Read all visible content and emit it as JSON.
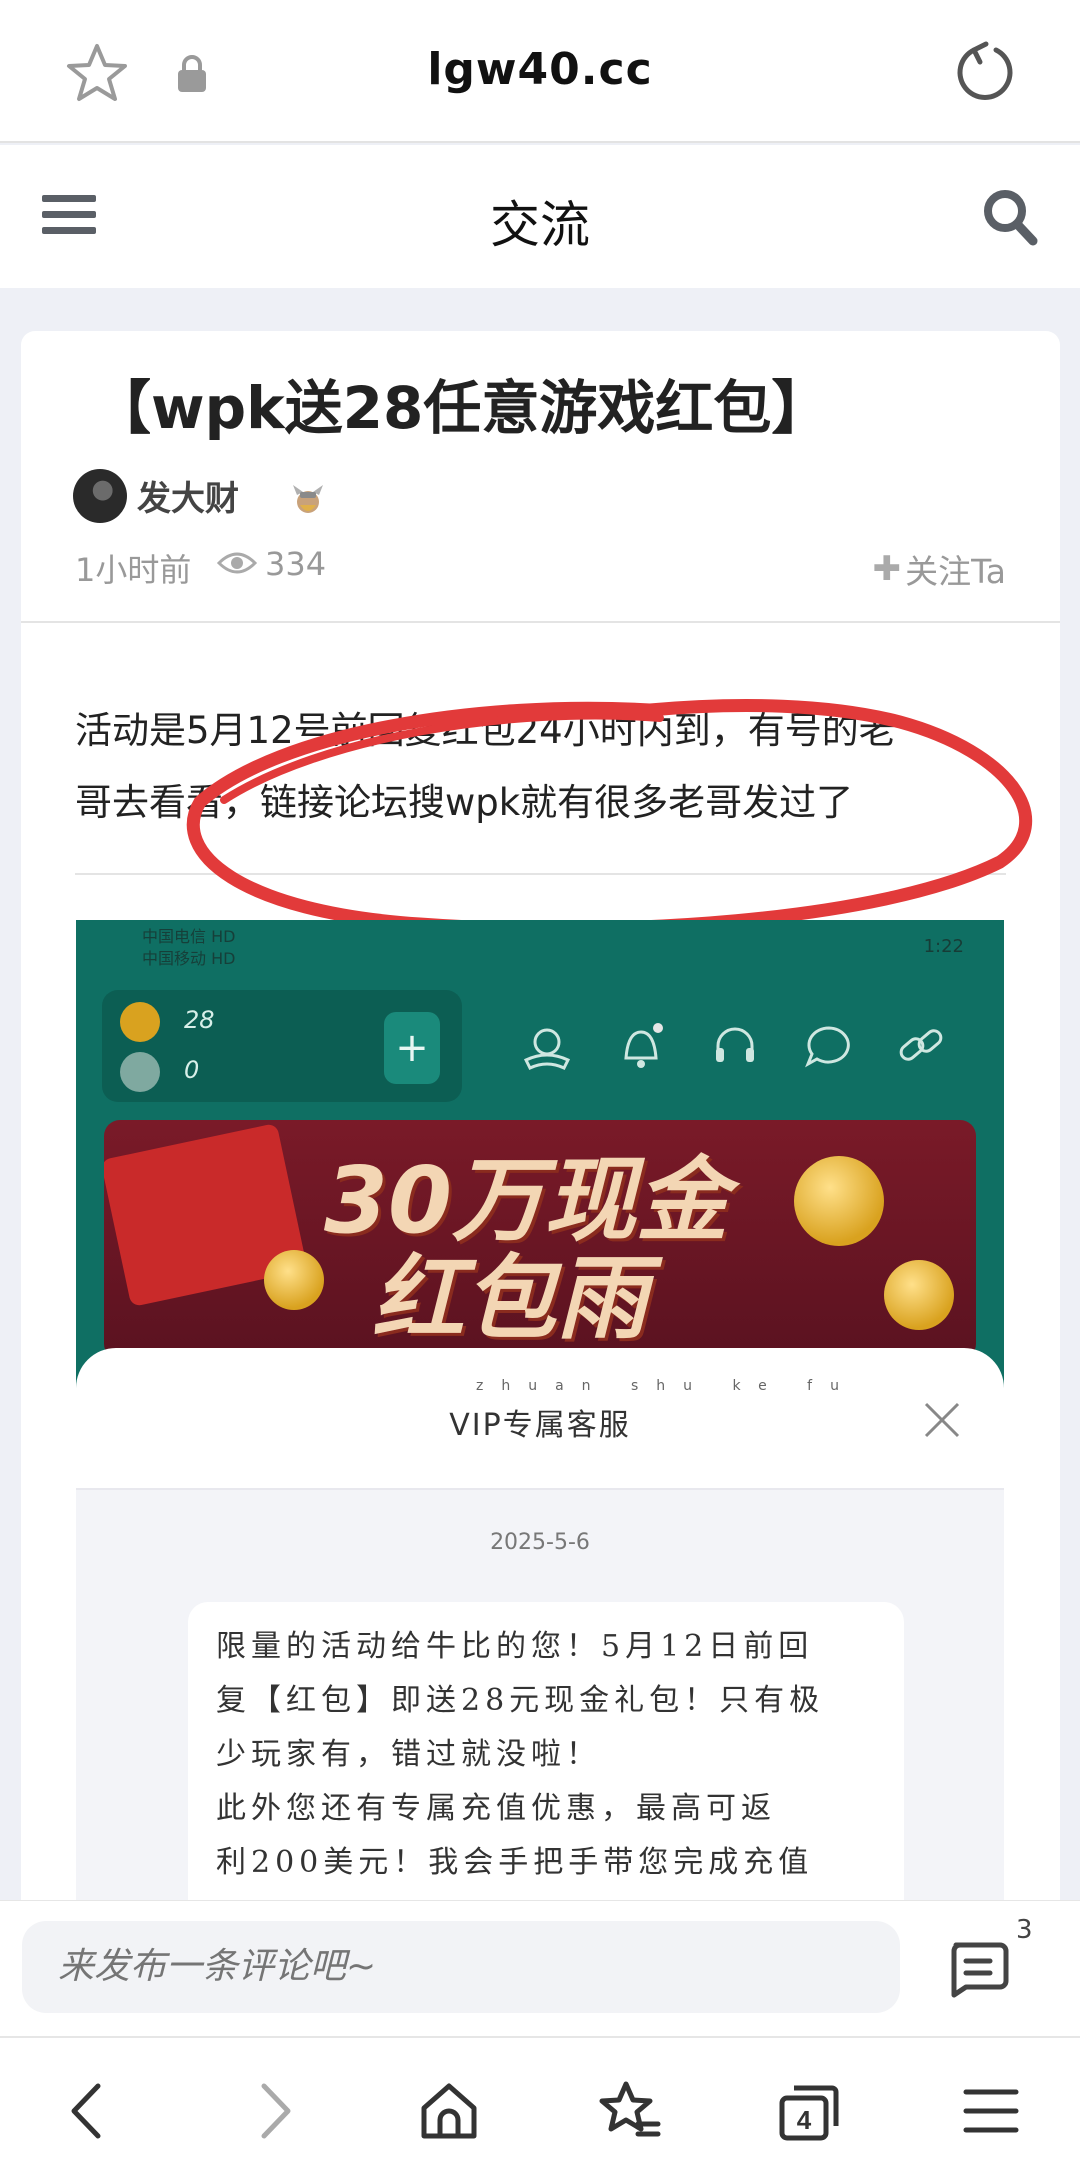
{
  "browser": {
    "url": "lgw40.cc",
    "tab_count": "4"
  },
  "site_header": {
    "title": "交流"
  },
  "post": {
    "title": "【wpk送28任意游戏红包】",
    "author": "发大财",
    "time": "1小时前",
    "views": "334",
    "follow_label": "关注Ta",
    "body_line1": "活动是5月12号前回复红包24小时内到，有号的老",
    "body_line2": "哥去看看，链接论坛搜wpk就有很多老哥发过了"
  },
  "screenshot": {
    "status_left_1": "中国电信 HD",
    "status_left_2": "中国移动 HD",
    "status_right": "1:22",
    "wallet_coin": "28",
    "wallet_cash": "0",
    "banner_line1": "30万现金",
    "banner_line2": "红包雨",
    "sheet_title": "VIP专属客服",
    "sheet_title_pinyin": "zhuan shu ke fu",
    "chat_date": "2025-5-6",
    "message_lines": [
      "限量的活动给牛比的您！5月12日前回",
      "复【红包】即送28元现金礼包！只有极",
      "少玩家有，错过就没啦！",
      "此外您还有专属充值优惠，最高可返",
      "利200美元！我会手把手带您完成充值"
    ]
  },
  "comment": {
    "placeholder": "来发布一条评论吧~",
    "count": "3"
  },
  "colors": {
    "annotation": "#e23a3a",
    "teal": "#0f6f63",
    "banner_red": "#7a1a28"
  }
}
